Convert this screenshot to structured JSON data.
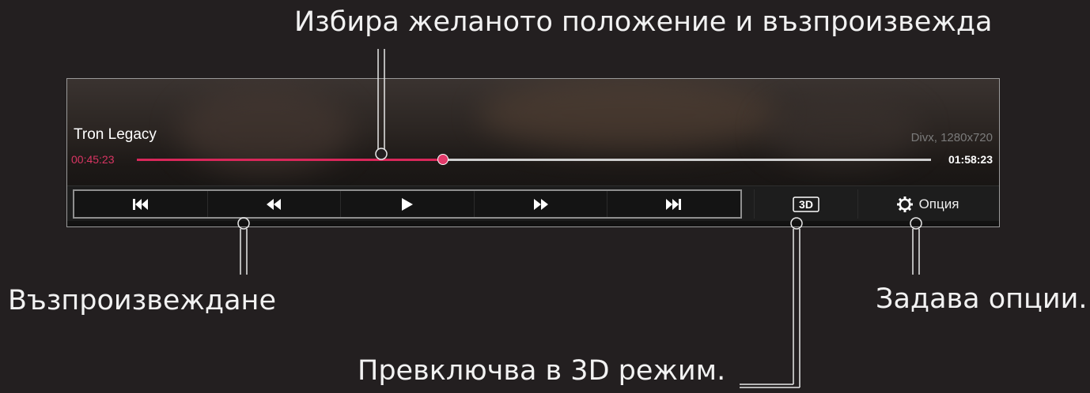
{
  "callouts": {
    "seek": "Избира желаното положение и възпроизвежда",
    "playback": "Възпроизвеждане",
    "options": "Задава опции.",
    "mode3d": "Превключва в 3D режим."
  },
  "player": {
    "title": "Tron Legacy",
    "format": "Divx, 1280x720",
    "current_time": "00:45:23",
    "total_time": "01:58:23",
    "progress": 0.385,
    "controls": [
      {
        "name": "skip-previous-button",
        "icon": "skip-previous-icon"
      },
      {
        "name": "rewind-button",
        "icon": "rewind-icon"
      },
      {
        "name": "play-button",
        "icon": "play-icon"
      },
      {
        "name": "fast-forward-button",
        "icon": "fast-forward-icon"
      },
      {
        "name": "skip-next-button",
        "icon": "skip-next-icon"
      }
    ],
    "mode3d_label": "3D",
    "options_label": "Опция"
  },
  "colors": {
    "accent": "#d9275a",
    "background": "#231f20"
  }
}
